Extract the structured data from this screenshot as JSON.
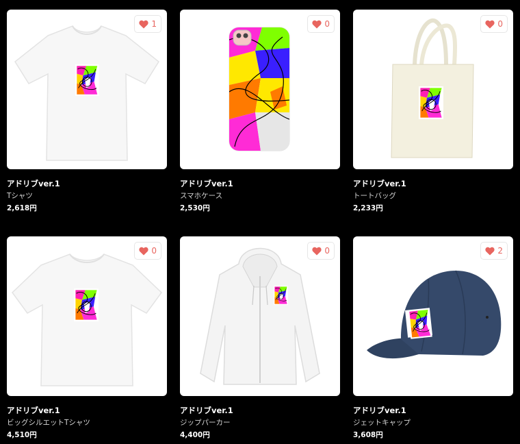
{
  "colors": {
    "background": "#000000",
    "like_heart": "#e8655f"
  },
  "products": [
    {
      "title": "アドリブver.1",
      "type": "Tシャツ",
      "price": "2,618円",
      "likes": "1",
      "image": "t-shirt"
    },
    {
      "title": "アドリブver.1",
      "type": "スマホケース",
      "price": "2,530円",
      "likes": "0",
      "image": "smartphone-case"
    },
    {
      "title": "アドリブver.1",
      "type": "トートバッグ",
      "price": "2,233円",
      "likes": "0",
      "image": "tote-bag"
    },
    {
      "title": "アドリブver.1",
      "type": "ビッグシルエットTシャツ",
      "price": "4,510円",
      "likes": "0",
      "image": "big-silhouette-t-shirt"
    },
    {
      "title": "アドリブver.1",
      "type": "ジップパーカー",
      "price": "4,400円",
      "likes": "0",
      "image": "zip-hoodie"
    },
    {
      "title": "アドリブver.1",
      "type": "ジェットキャップ",
      "price": "3,608円",
      "likes": "2",
      "image": "jet-cap"
    }
  ]
}
